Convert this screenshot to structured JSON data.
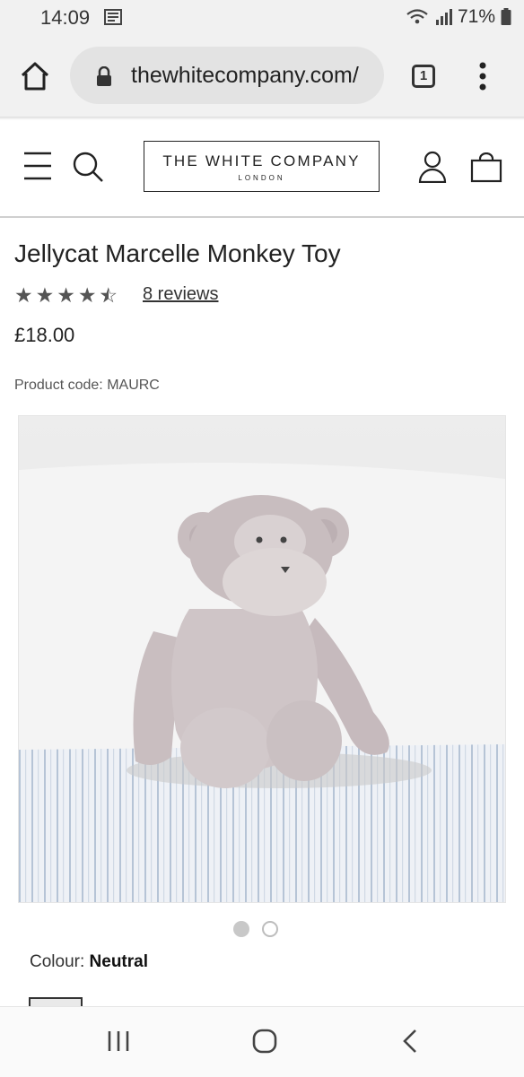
{
  "status_bar": {
    "time": "14:09",
    "battery": "71%",
    "icons": [
      "notification-icon",
      "wifi-icon",
      "signal-icon",
      "battery-icon"
    ]
  },
  "browser": {
    "url": "thewhitecompany.com/",
    "tab_count": "1",
    "icons": [
      "home-icon",
      "lock-icon",
      "tabs-icon",
      "more-vert-icon"
    ]
  },
  "header": {
    "logo_main": "THE WHITE COMPANY",
    "logo_sub": "LONDON",
    "icons": [
      "hamburger-menu-icon",
      "search-icon",
      "account-icon",
      "bag-icon"
    ]
  },
  "product": {
    "title": "Jellycat Marcelle Monkey Toy",
    "rating": 4.5,
    "rating_max": 5,
    "reviews_label": "8 reviews",
    "price": "£18.00",
    "code_label": "Product code:",
    "code_value": "MAURC",
    "image_count": 2,
    "active_image": 1,
    "colour_label": "Colour:",
    "colour_value": "Neutral"
  },
  "android_nav": {
    "icons": [
      "recent-apps-icon",
      "home-circle-icon",
      "back-icon"
    ]
  },
  "colors": {
    "chrome_bg": "#f1f1f1",
    "url_pill": "#e3e3e3",
    "text": "#222222",
    "star": "#555555"
  }
}
